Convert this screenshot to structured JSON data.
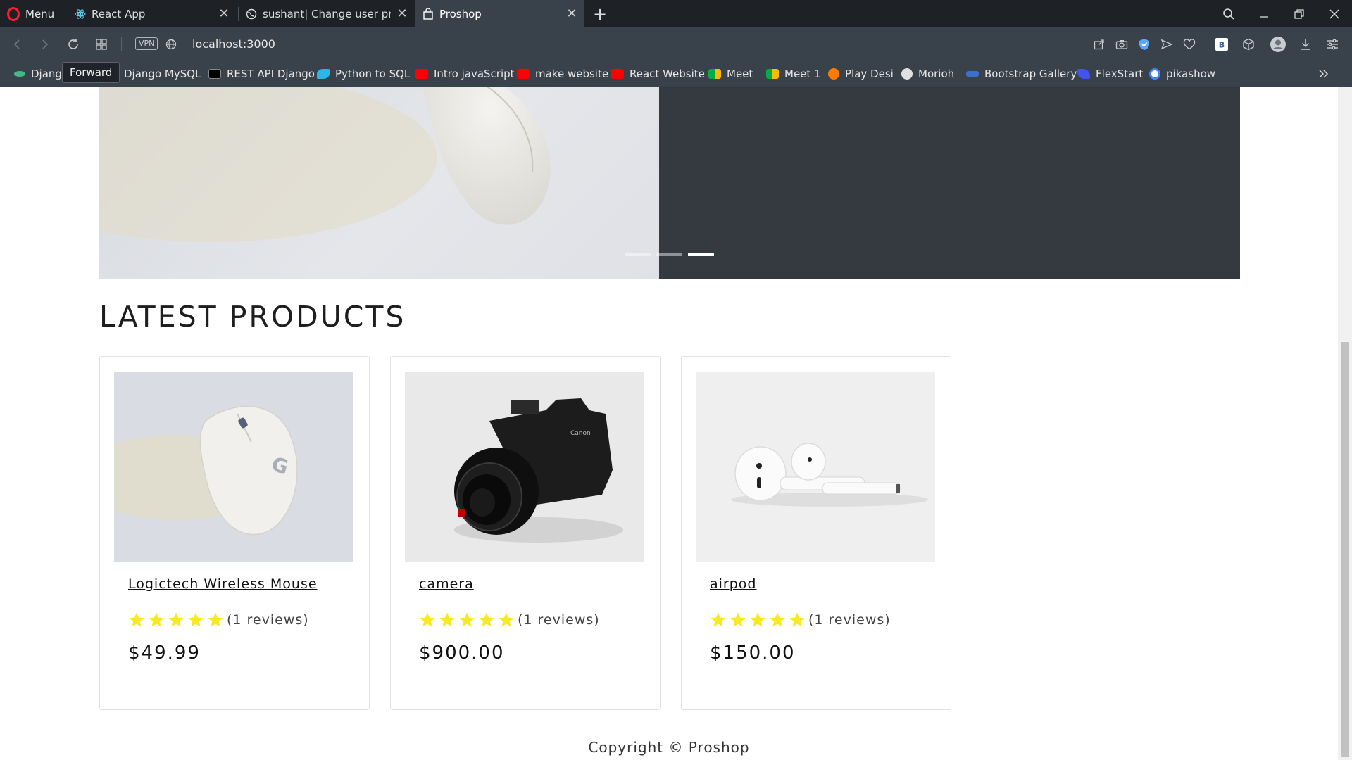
{
  "browser": {
    "menu_label": "Menu",
    "tabs": [
      {
        "title": "React App"
      },
      {
        "title": "sushant| Change user profi"
      },
      {
        "title": "Proshop"
      }
    ],
    "url": "localhost:3000",
    "vpn_label": "VPN",
    "tooltip": "Forward",
    "bookmarks": [
      {
        "label": "Djang",
        "icon": "django-icon",
        "color": "#44b78b"
      },
      {
        "label": "Django MySQL",
        "icon": "django-icon",
        "color": "#44b78b"
      },
      {
        "label": "REST API Django",
        "icon": "medium-icon",
        "color": "#000000"
      },
      {
        "label": "Python to SQL",
        "icon": "bird-icon",
        "color": "#2bb5e8"
      },
      {
        "label": "Intro javaScript",
        "icon": "youtube-icon",
        "color": "#ff0000"
      },
      {
        "label": "make website",
        "icon": "youtube-icon",
        "color": "#ff0000"
      },
      {
        "label": "React Website",
        "icon": "youtube-icon",
        "color": "#ff0000"
      },
      {
        "label": "Meet",
        "icon": "meet-icon",
        "color": "#00ac47"
      },
      {
        "label": "Meet 1",
        "icon": "meet-icon",
        "color": "#00ac47"
      },
      {
        "label": "Play Desi",
        "icon": "play-icon",
        "color": "#ff7a00"
      },
      {
        "label": "Morioh",
        "icon": "morioh-icon",
        "color": "#e0e0e0"
      },
      {
        "label": "Bootstrap Gallery",
        "icon": "mdb-icon",
        "color": "#3b71ca"
      },
      {
        "label": "FlexStart",
        "icon": "flexstart-icon",
        "color": "#4154f1"
      },
      {
        "label": "pikashow",
        "icon": "google-icon",
        "color": "#ffffff"
      }
    ]
  },
  "carousel": {
    "indicator_count": 3,
    "active_indicator": 3
  },
  "section_title": "LATEST PRODUCTS",
  "products": [
    {
      "name": "Logictech Wireless Mouse",
      "rating": 5,
      "reviews": "(1 reviews)",
      "price": "$49.99"
    },
    {
      "name": "camera",
      "rating": 5,
      "reviews": "(1 reviews)",
      "price": "$900.00"
    },
    {
      "name": "airpod",
      "rating": 5,
      "reviews": "(1 reviews)",
      "price": "$150.00"
    }
  ],
  "footer": "Copyright © Proshop",
  "colors": {
    "star": "#f8e825",
    "carousel_bg": "#343a40",
    "chrome_bg": "#39414b"
  }
}
